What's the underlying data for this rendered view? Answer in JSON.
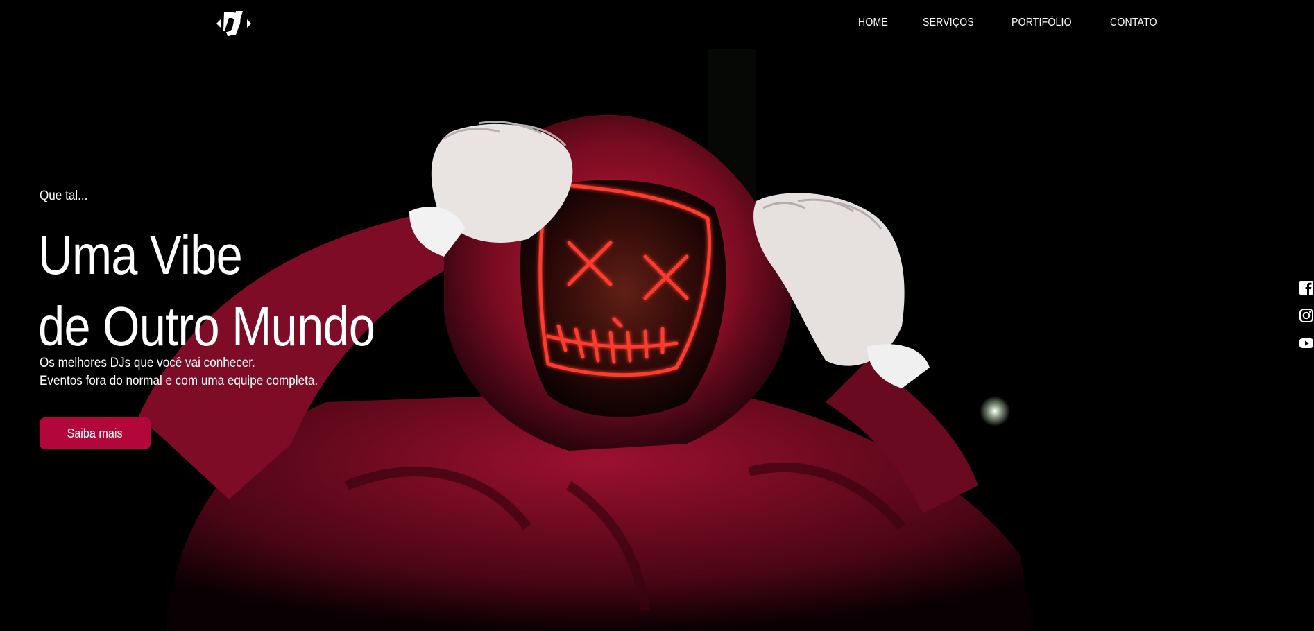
{
  "nav": {
    "items": [
      {
        "label": "HOME"
      },
      {
        "label": "SERVIÇOS"
      },
      {
        "label": "PORTIFÓLIO"
      },
      {
        "label": "CONTATO"
      }
    ]
  },
  "logo": {
    "icon": "dj-logo-icon"
  },
  "hero": {
    "eyebrow": "Que tal...",
    "title_line1": "Uma Vibe",
    "title_line2": "de Outro Mundo",
    "subtitle_line1": "Os melhores DJs que você vai conhecer.",
    "subtitle_line2": "Eventos fora do normal e com uma equipe completa.",
    "cta_label": "Saiba mais"
  },
  "social": {
    "items": [
      {
        "icon": "facebook-icon"
      },
      {
        "icon": "instagram-icon"
      },
      {
        "icon": "youtube-icon"
      }
    ]
  },
  "colors": {
    "background": "#000000",
    "accent": "#b3073b",
    "hoodie": "#8e0f2a",
    "mask_glow": "#ff3b2f"
  }
}
